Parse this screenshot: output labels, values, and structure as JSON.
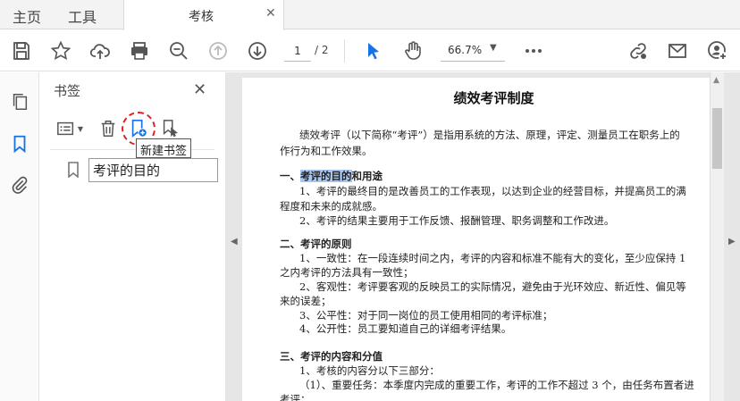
{
  "tabs": {
    "home": "主页",
    "tools": "工具",
    "document": "考核",
    "close_glyph": "✕"
  },
  "toolbar": {
    "page_current": "1",
    "page_total": "/ 2",
    "zoom": "66.7%",
    "zoom_caret": "▼",
    "icons": [
      "save-icon",
      "star-icon",
      "upload-icon",
      "print-icon",
      "zoom-out-icon",
      "prev-page-icon",
      "next-page-icon",
      "select-cursor-icon",
      "hand-icon",
      "more-icon",
      "link-icon",
      "mail-icon",
      "add-user-icon"
    ]
  },
  "rail": {
    "icons": [
      "pages-icon",
      "bookmark-icon",
      "attachment-icon"
    ]
  },
  "panel": {
    "title": "书签",
    "close_glyph": "✕",
    "tooltip": "新建书签",
    "bookmark_value": "考评的目的"
  },
  "document": {
    "title": "绩效考评制度",
    "lines": [
      "绩效考评（以下简称“考评”）是指用系统的方法、原理，评定、测量员工在职务上的",
      "作行为和工作效果。",
      "和用途",
      "1、考评的最终目的是改善员工的工作表现，以达到企业的经营目标，并提高员工的满",
      "程度和未来的成就感。",
      "2、考评的结果主要用于工作反馈、报酬管理、职务调整和工作改进。",
      "二、考评的原则",
      "1、一致性：在一段连续时间之内，考评的内容和标准不能有大的变化，至少应保持 1",
      "之内考评的方法具有一致性；",
      "2、客观性：考评要客观的反映员工的实际情况，避免由于光环效应、新近性、偏见等",
      "来的误差；",
      "3、公平性：对于同一岗位的员工使用相同的考评标准；",
      "4、公开性：员工要知道自己的详细考评结果。",
      "三、考评的内容和分值",
      "1、考核的内容分以下三部分：",
      "（1）、重要任务：本季度内完成的重要工作，考评的工作不超过 3 个，由任务布置者进",
      "考评；"
    ],
    "heading1_prefix": "一、",
    "heading1_highlight": "考评的目的"
  },
  "colors": {
    "accent": "#1473e6",
    "highlight": "#a9c7ee",
    "annotation": "#e02020"
  }
}
